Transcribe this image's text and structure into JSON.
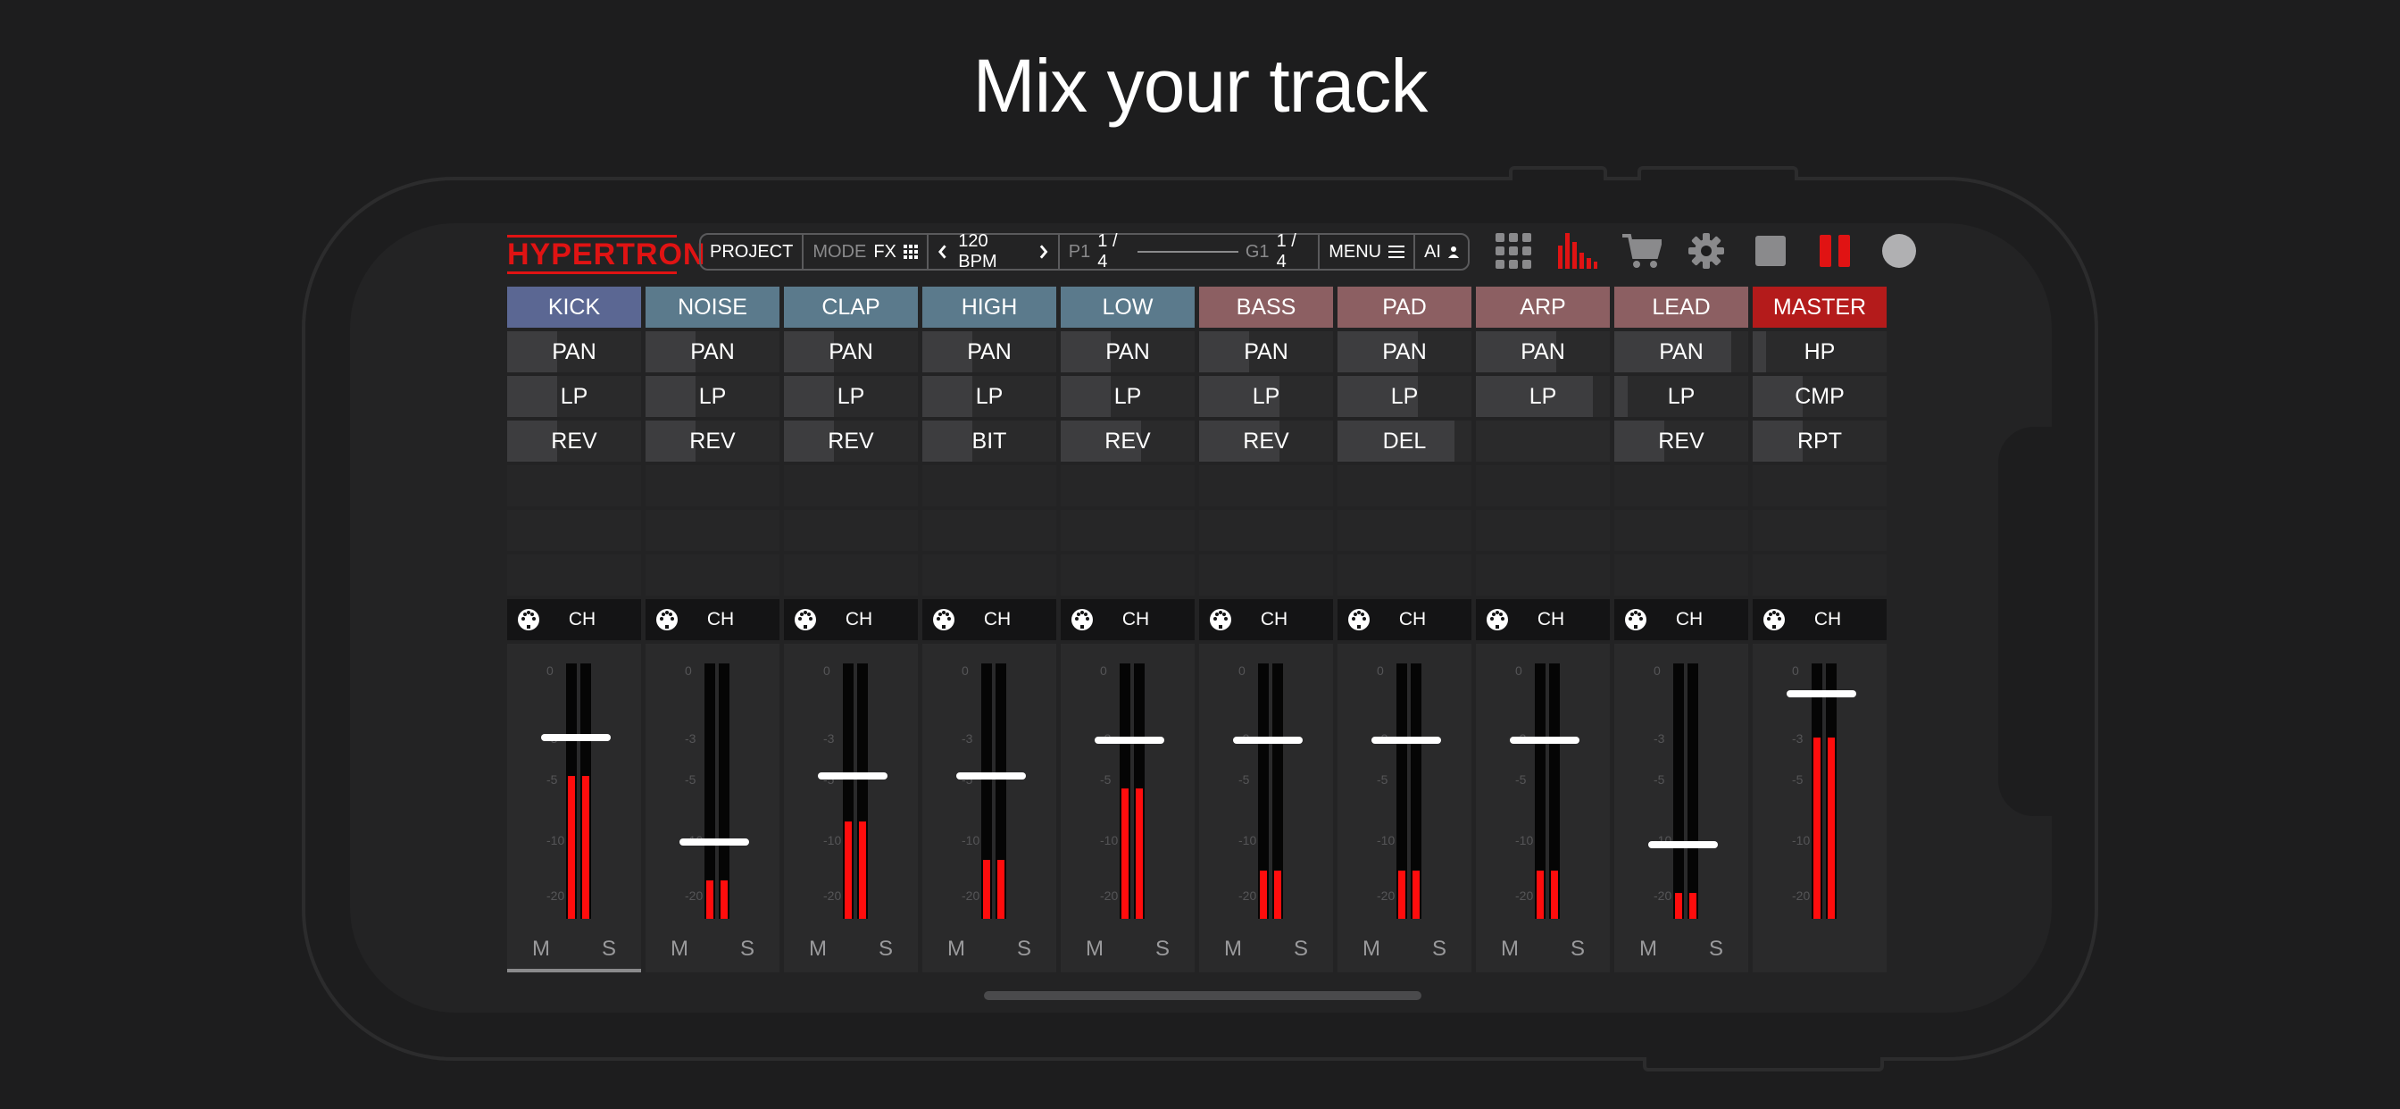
{
  "headline": "Mix your track",
  "app": {
    "logo": "HYPERTRON",
    "toolbar": {
      "project": "PROJECT",
      "mode_label": "MODE",
      "mode_value": "FX",
      "bpm": "120 BPM",
      "pattern_label": "P1",
      "pattern_value": "1 / 4",
      "group_label": "G1",
      "group_value": "1 / 4",
      "menu": "MENU",
      "ai": "AI"
    },
    "icons": [
      "grid-icon",
      "mixer-bars-icon",
      "cart-icon",
      "gear-icon",
      "stop-icon",
      "pause-icon",
      "record-icon"
    ],
    "colors": {
      "accent_red": "#e01313",
      "meter_red": "#ff0d0d"
    }
  },
  "channels": [
    {
      "name": "KICK",
      "color": "#5b6793",
      "fx": [
        "PAN",
        "LP",
        "REV"
      ],
      "ch": "CH",
      "level": 0.71,
      "meter": 0.56,
      "m": "M",
      "s": "S"
    },
    {
      "name": "NOISE",
      "color": "#5b7a8c",
      "fx": [
        "PAN",
        "LP",
        "REV"
      ],
      "ch": "CH",
      "level": 0.3,
      "meter": 0.15,
      "m": "M",
      "s": "S"
    },
    {
      "name": "CLAP",
      "color": "#5b7a8c",
      "fx": [
        "PAN",
        "LP",
        "REV"
      ],
      "ch": "CH",
      "level": 0.56,
      "meter": 0.38,
      "m": "M",
      "s": "S"
    },
    {
      "name": "HIGH",
      "color": "#5b7a8c",
      "fx": [
        "PAN",
        "LP",
        "BIT"
      ],
      "ch": "CH",
      "level": 0.56,
      "meter": 0.23,
      "m": "M",
      "s": "S"
    },
    {
      "name": "LOW",
      "color": "#5b7a8c",
      "fx": [
        "PAN",
        "LP",
        "REV"
      ],
      "ch": "CH",
      "level": 0.7,
      "meter": 0.51,
      "m": "M",
      "s": "S"
    },
    {
      "name": "BASS",
      "color": "#8c5f62",
      "fx": [
        "PAN",
        "LP",
        "REV"
      ],
      "ch": "CH",
      "level": 0.7,
      "meter": 0.19,
      "m": "M",
      "s": "S"
    },
    {
      "name": "PAD",
      "color": "#8c5f62",
      "fx": [
        "PAN",
        "LP",
        "DEL"
      ],
      "ch": "CH",
      "level": 0.7,
      "meter": 0.19,
      "m": "M",
      "s": "S"
    },
    {
      "name": "ARP",
      "color": "#8c5f62",
      "fx": [
        "PAN",
        "LP",
        ""
      ],
      "ch": "CH",
      "level": 0.7,
      "meter": 0.19,
      "m": "M",
      "s": "S"
    },
    {
      "name": "LEAD",
      "color": "#8c5f62",
      "fx": [
        "PAN",
        "LP",
        "REV"
      ],
      "ch": "CH",
      "level": 0.29,
      "meter": 0.1,
      "m": "M",
      "s": "S"
    },
    {
      "name": "MASTER",
      "color": "#b41b1b",
      "fx": [
        "HP",
        "CMP",
        "RPT"
      ],
      "ch": "CH",
      "level": 0.88,
      "meter": 0.71,
      "m": "",
      "s": ""
    }
  ],
  "scale_marks": [
    "0",
    "-3",
    "-5",
    "-10",
    "-20"
  ]
}
